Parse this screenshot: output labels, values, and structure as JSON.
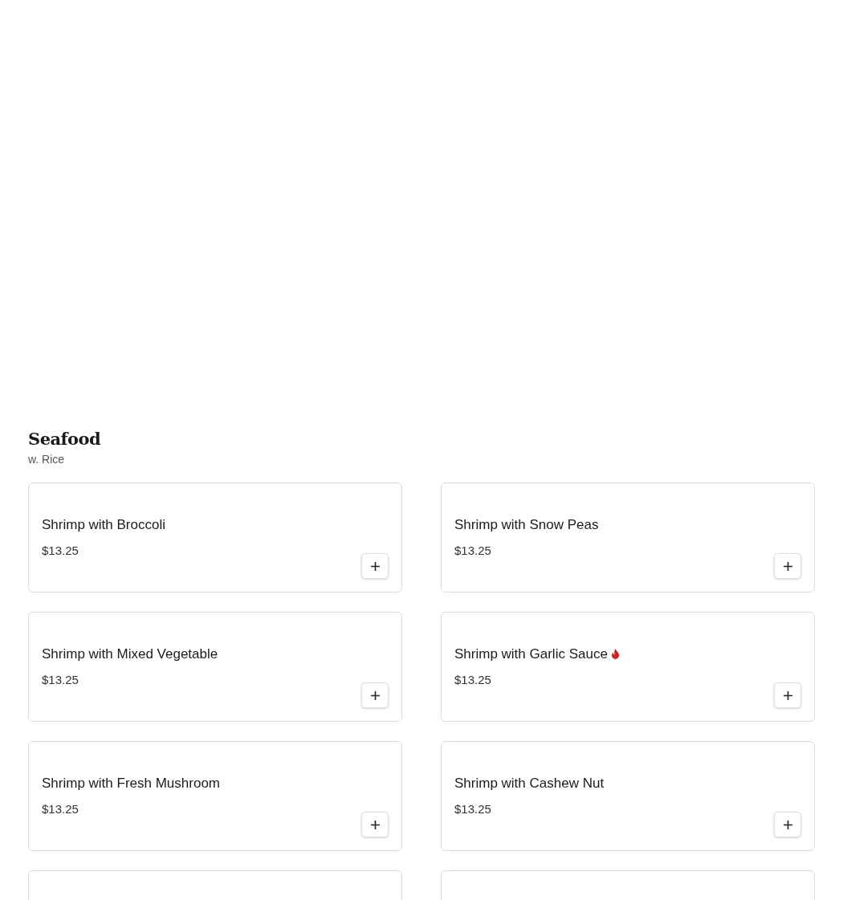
{
  "section": {
    "title": "Seafood",
    "subtitle": "w. Rice"
  },
  "items": [
    {
      "name": "Shrimp with Broccoli",
      "price": "$13.25",
      "spicy": false
    },
    {
      "name": "Shrimp with Snow Peas",
      "price": "$13.25",
      "spicy": false
    },
    {
      "name": "Shrimp with Mixed Vegetable",
      "price": "$13.25",
      "spicy": false
    },
    {
      "name": "Shrimp with Garlic Sauce",
      "price": "$13.25",
      "spicy": true
    },
    {
      "name": "Shrimp with Fresh Mushroom",
      "price": "$13.25",
      "spicy": false
    },
    {
      "name": "Shrimp with Cashew Nut",
      "price": "$13.25",
      "spicy": false
    }
  ]
}
